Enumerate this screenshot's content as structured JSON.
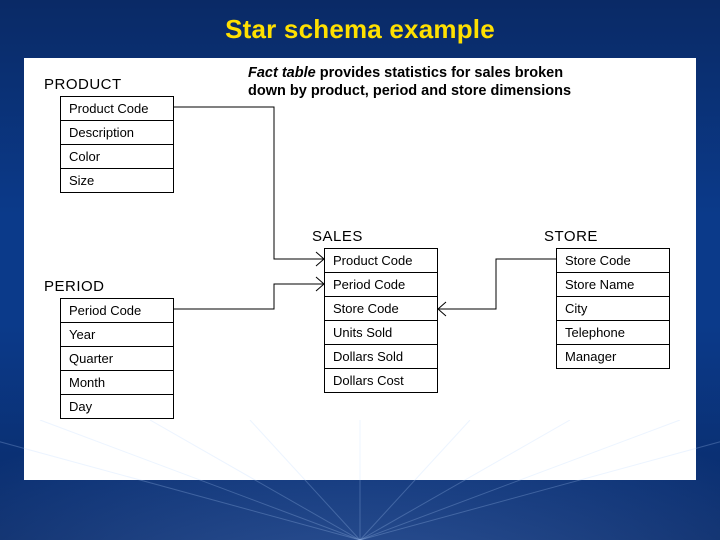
{
  "slide": {
    "title": "Star schema example",
    "caption_bold": "Fact table",
    "caption_rest": " provides statistics for sales broken down by product, period and store dimensions"
  },
  "tables": {
    "product": {
      "title": "PRODUCT",
      "fields": [
        "Product Code",
        "Description",
        "Color",
        "Size"
      ]
    },
    "period": {
      "title": "PERIOD",
      "fields": [
        "Period Code",
        "Year",
        "Quarter",
        "Month",
        "Day"
      ]
    },
    "sales": {
      "title": "SALES",
      "fields": [
        "Product Code",
        "Period Code",
        "Store Code",
        "Units Sold",
        "Dollars Sold",
        "Dollars Cost"
      ]
    },
    "store": {
      "title": "STORE",
      "fields": [
        "Store Code",
        "Store Name",
        "City",
        "Telephone",
        "Manager"
      ]
    }
  }
}
